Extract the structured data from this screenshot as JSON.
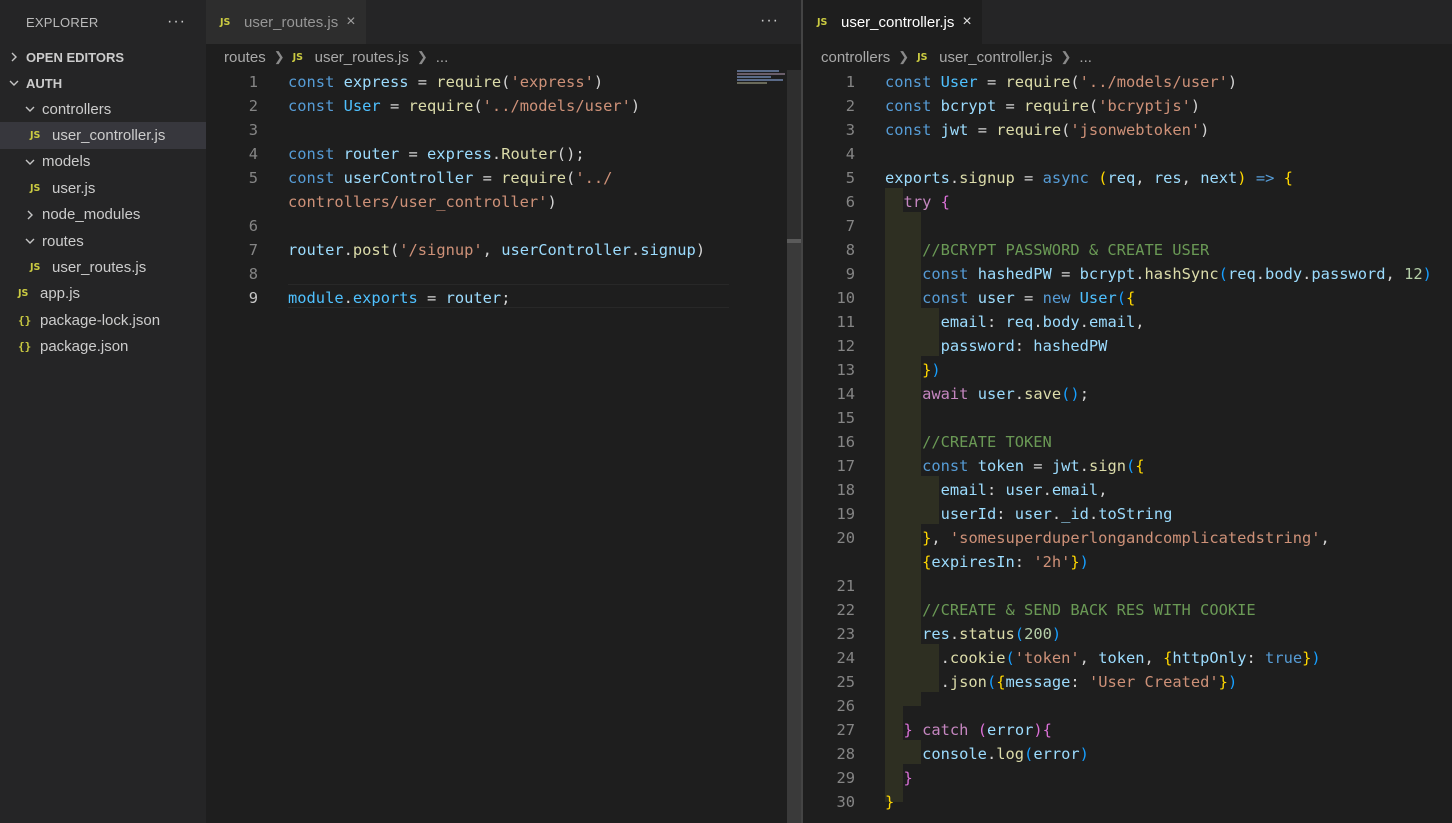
{
  "sidebar": {
    "title": "EXPLORER",
    "more": "···",
    "open_editors": "OPEN EDITORS",
    "project": "AUTH",
    "items": [
      {
        "label": "controllers"
      },
      {
        "label": "user_controller.js"
      },
      {
        "label": "models"
      },
      {
        "label": "user.js"
      },
      {
        "label": "node_modules"
      },
      {
        "label": "routes"
      },
      {
        "label": "user_routes.js"
      },
      {
        "label": "app.js"
      },
      {
        "label": "package-lock.json"
      },
      {
        "label": "package.json"
      }
    ],
    "js_badge": "JS",
    "json_badge": "{}"
  },
  "left_editor": {
    "tab": {
      "label": "user_routes.js",
      "close": "×"
    },
    "more": "···",
    "breadcrumb": {
      "folder": "routes",
      "file": "user_routes.js",
      "ellipsis": "..."
    },
    "lines": [
      {
        "n": "1",
        "parts": [
          [
            "kw",
            "const "
          ],
          [
            "var",
            "express"
          ],
          [
            "pl",
            " = "
          ],
          [
            "fn",
            "require"
          ],
          [
            "pl",
            "("
          ],
          [
            "str",
            "'express'"
          ],
          [
            "pl",
            ")"
          ]
        ]
      },
      {
        "n": "2",
        "parts": [
          [
            "kw",
            "const "
          ],
          [
            "const",
            "User"
          ],
          [
            "pl",
            " = "
          ],
          [
            "fn",
            "require"
          ],
          [
            "pl",
            "("
          ],
          [
            "str",
            "'../models/user'"
          ],
          [
            "pl",
            ")"
          ]
        ]
      },
      {
        "n": "3",
        "parts": []
      },
      {
        "n": "4",
        "parts": [
          [
            "kw",
            "const "
          ],
          [
            "var",
            "router"
          ],
          [
            "pl",
            " = "
          ],
          [
            "var",
            "express"
          ],
          [
            "pl",
            "."
          ],
          [
            "fn",
            "Router"
          ],
          [
            "pl",
            "();"
          ]
        ]
      },
      {
        "n": "5",
        "parts": [
          [
            "kw",
            "const "
          ],
          [
            "var",
            "userController"
          ],
          [
            "pl",
            " = "
          ],
          [
            "fn",
            "require"
          ],
          [
            "pl",
            "("
          ],
          [
            "str",
            "'../"
          ]
        ]
      },
      {
        "n": "",
        "parts": [
          [
            "str",
            "controllers/user_controller'"
          ],
          [
            "pl",
            ")"
          ]
        ]
      },
      {
        "n": "6",
        "parts": []
      },
      {
        "n": "7",
        "parts": [
          [
            "var",
            "router"
          ],
          [
            "pl",
            "."
          ],
          [
            "fn",
            "post"
          ],
          [
            "pl",
            "("
          ],
          [
            "str",
            "'/signup'"
          ],
          [
            "pl",
            ", "
          ],
          [
            "var",
            "userController"
          ],
          [
            "pl",
            "."
          ],
          [
            "var",
            "signup"
          ],
          [
            "pl",
            ")"
          ]
        ]
      },
      {
        "n": "8",
        "parts": []
      },
      {
        "n": "9",
        "parts": [
          [
            "const",
            "module"
          ],
          [
            "pl",
            "."
          ],
          [
            "const",
            "exports"
          ],
          [
            "pl",
            " = "
          ],
          [
            "var",
            "router"
          ],
          [
            "pl",
            ";"
          ]
        ]
      }
    ]
  },
  "right_editor": {
    "tab": {
      "label": "user_controller.js",
      "close": "×"
    },
    "breadcrumb": {
      "folder": "controllers",
      "file": "user_controller.js",
      "ellipsis": "..."
    },
    "lines": [
      {
        "n": "1",
        "parts": [
          [
            "kw",
            "const "
          ],
          [
            "const",
            "User"
          ],
          [
            "pl",
            " = "
          ],
          [
            "fn",
            "require"
          ],
          [
            "pl",
            "("
          ],
          [
            "str",
            "'../models/user'"
          ],
          [
            "pl",
            ")"
          ]
        ]
      },
      {
        "n": "2",
        "parts": [
          [
            "kw",
            "const "
          ],
          [
            "var",
            "bcrypt"
          ],
          [
            "pl",
            " = "
          ],
          [
            "fn",
            "require"
          ],
          [
            "pl",
            "("
          ],
          [
            "str",
            "'bcryptjs'"
          ],
          [
            "pl",
            ")"
          ]
        ]
      },
      {
        "n": "3",
        "parts": [
          [
            "kw",
            "const "
          ],
          [
            "var",
            "jwt"
          ],
          [
            "pl",
            " = "
          ],
          [
            "fn",
            "require"
          ],
          [
            "pl",
            "("
          ],
          [
            "str",
            "'jsonwebtoken'"
          ],
          [
            "pl",
            ")"
          ]
        ]
      },
      {
        "n": "4",
        "parts": []
      },
      {
        "n": "5",
        "parts": [
          [
            "var",
            "exports"
          ],
          [
            "pl",
            "."
          ],
          [
            "fn",
            "signup"
          ],
          [
            "pl",
            " = "
          ],
          [
            "kw",
            "async"
          ],
          [
            "pl",
            " "
          ],
          [
            "b1",
            "("
          ],
          [
            "var",
            "req"
          ],
          [
            "pl",
            ", "
          ],
          [
            "var",
            "res"
          ],
          [
            "pl",
            ", "
          ],
          [
            "var",
            "next"
          ],
          [
            "b1",
            ")"
          ],
          [
            "pl",
            " "
          ],
          [
            "kw",
            "=>"
          ],
          [
            "pl",
            " "
          ],
          [
            "b1",
            "{"
          ]
        ]
      },
      {
        "n": "6",
        "parts": [
          [
            "pl",
            "  "
          ],
          [
            "ctl",
            "try"
          ],
          [
            "pl",
            " "
          ],
          [
            "b2",
            "{"
          ]
        ]
      },
      {
        "n": "7",
        "parts": []
      },
      {
        "n": "8",
        "parts": [
          [
            "pl",
            "    "
          ],
          [
            "cm",
            "//BCRYPT PASSWORD & CREATE USER"
          ]
        ]
      },
      {
        "n": "9",
        "parts": [
          [
            "pl",
            "    "
          ],
          [
            "kw",
            "const "
          ],
          [
            "var",
            "hashedPW"
          ],
          [
            "pl",
            " = "
          ],
          [
            "var",
            "bcrypt"
          ],
          [
            "pl",
            "."
          ],
          [
            "fn",
            "hashSync"
          ],
          [
            "b3",
            "("
          ],
          [
            "var",
            "req"
          ],
          [
            "pl",
            "."
          ],
          [
            "var",
            "body"
          ],
          [
            "pl",
            "."
          ],
          [
            "var",
            "password"
          ],
          [
            "pl",
            ", "
          ],
          [
            "num",
            "12"
          ],
          [
            "b3",
            ")"
          ]
        ]
      },
      {
        "n": "10",
        "parts": [
          [
            "pl",
            "    "
          ],
          [
            "kw",
            "const "
          ],
          [
            "var",
            "user"
          ],
          [
            "pl",
            " = "
          ],
          [
            "kw",
            "new "
          ],
          [
            "const",
            "User"
          ],
          [
            "b3",
            "("
          ],
          [
            "b1",
            "{"
          ]
        ]
      },
      {
        "n": "11",
        "parts": [
          [
            "pl",
            "      "
          ],
          [
            "var",
            "email"
          ],
          [
            "pl",
            ": "
          ],
          [
            "var",
            "req"
          ],
          [
            "pl",
            "."
          ],
          [
            "var",
            "body"
          ],
          [
            "pl",
            "."
          ],
          [
            "var",
            "email"
          ],
          [
            "pl",
            ","
          ]
        ]
      },
      {
        "n": "12",
        "parts": [
          [
            "pl",
            "      "
          ],
          [
            "var",
            "password"
          ],
          [
            "pl",
            ": "
          ],
          [
            "var",
            "hashedPW"
          ]
        ]
      },
      {
        "n": "13",
        "parts": [
          [
            "pl",
            "    "
          ],
          [
            "b1",
            "}"
          ],
          [
            "b3",
            ")"
          ]
        ]
      },
      {
        "n": "14",
        "parts": [
          [
            "pl",
            "    "
          ],
          [
            "ctl",
            "await"
          ],
          [
            "pl",
            " "
          ],
          [
            "var",
            "user"
          ],
          [
            "pl",
            "."
          ],
          [
            "fn",
            "save"
          ],
          [
            "b3",
            "()"
          ],
          [
            "pl",
            ";"
          ]
        ]
      },
      {
        "n": "15",
        "parts": []
      },
      {
        "n": "16",
        "parts": [
          [
            "pl",
            "    "
          ],
          [
            "cm",
            "//CREATE TOKEN"
          ]
        ]
      },
      {
        "n": "17",
        "parts": [
          [
            "pl",
            "    "
          ],
          [
            "kw",
            "const "
          ],
          [
            "var",
            "token"
          ],
          [
            "pl",
            " = "
          ],
          [
            "var",
            "jwt"
          ],
          [
            "pl",
            "."
          ],
          [
            "fn",
            "sign"
          ],
          [
            "b3",
            "("
          ],
          [
            "b1",
            "{"
          ]
        ]
      },
      {
        "n": "18",
        "parts": [
          [
            "pl",
            "      "
          ],
          [
            "var",
            "email"
          ],
          [
            "pl",
            ": "
          ],
          [
            "var",
            "user"
          ],
          [
            "pl",
            "."
          ],
          [
            "var",
            "email"
          ],
          [
            "pl",
            ","
          ]
        ]
      },
      {
        "n": "19",
        "parts": [
          [
            "pl",
            "      "
          ],
          [
            "var",
            "userId"
          ],
          [
            "pl",
            ": "
          ],
          [
            "var",
            "user"
          ],
          [
            "pl",
            "."
          ],
          [
            "var",
            "_id"
          ],
          [
            "pl",
            "."
          ],
          [
            "var",
            "toString"
          ]
        ]
      },
      {
        "n": "20",
        "parts": [
          [
            "pl",
            "    "
          ],
          [
            "b1",
            "}"
          ],
          [
            "pl",
            ", "
          ],
          [
            "str",
            "'somesuperduperlongandcomplicatedstring'"
          ],
          [
            "pl",
            ","
          ]
        ]
      },
      {
        "n": "",
        "parts": [
          [
            "pl",
            "    "
          ],
          [
            "b1",
            "{"
          ],
          [
            "var",
            "expiresIn"
          ],
          [
            "pl",
            ": "
          ],
          [
            "str",
            "'2h'"
          ],
          [
            "b1",
            "}"
          ],
          [
            "b3",
            ")"
          ]
        ]
      },
      {
        "n": "21",
        "parts": []
      },
      {
        "n": "22",
        "parts": [
          [
            "pl",
            "    "
          ],
          [
            "cm",
            "//CREATE & SEND BACK RES WITH COOKIE"
          ]
        ]
      },
      {
        "n": "23",
        "parts": [
          [
            "pl",
            "    "
          ],
          [
            "var",
            "res"
          ],
          [
            "pl",
            "."
          ],
          [
            "fn",
            "status"
          ],
          [
            "b3",
            "("
          ],
          [
            "num",
            "200"
          ],
          [
            "b3",
            ")"
          ]
        ]
      },
      {
        "n": "24",
        "parts": [
          [
            "pl",
            "      ."
          ],
          [
            "fn",
            "cookie"
          ],
          [
            "b3",
            "("
          ],
          [
            "str",
            "'token'"
          ],
          [
            "pl",
            ", "
          ],
          [
            "var",
            "token"
          ],
          [
            "pl",
            ", "
          ],
          [
            "b1",
            "{"
          ],
          [
            "var",
            "httpOnly"
          ],
          [
            "pl",
            ": "
          ],
          [
            "kw",
            "true"
          ],
          [
            "b1",
            "}"
          ],
          [
            "b3",
            ")"
          ]
        ]
      },
      {
        "n": "25",
        "parts": [
          [
            "pl",
            "      ."
          ],
          [
            "fn",
            "json"
          ],
          [
            "b3",
            "("
          ],
          [
            "b1",
            "{"
          ],
          [
            "var",
            "message"
          ],
          [
            "pl",
            ": "
          ],
          [
            "str",
            "'User Created'"
          ],
          [
            "b1",
            "}"
          ],
          [
            "b3",
            ")"
          ]
        ]
      },
      {
        "n": "26",
        "parts": []
      },
      {
        "n": "27",
        "parts": [
          [
            "pl",
            "  "
          ],
          [
            "b2",
            "}"
          ],
          [
            "pl",
            " "
          ],
          [
            "ctl",
            "catch"
          ],
          [
            "pl",
            " "
          ],
          [
            "b2",
            "("
          ],
          [
            "var",
            "error"
          ],
          [
            "b2",
            ")"
          ],
          [
            "b2",
            "{"
          ]
        ]
      },
      {
        "n": "28",
        "parts": [
          [
            "pl",
            "    "
          ],
          [
            "var",
            "console"
          ],
          [
            "pl",
            "."
          ],
          [
            "fn",
            "log"
          ],
          [
            "b3",
            "("
          ],
          [
            "var",
            "error"
          ],
          [
            "b3",
            ")"
          ]
        ]
      },
      {
        "n": "29",
        "parts": [
          [
            "pl",
            "  "
          ],
          [
            "b2",
            "}"
          ]
        ]
      },
      {
        "n": "30",
        "parts": [
          [
            "b1",
            "}"
          ]
        ]
      }
    ]
  },
  "colors": {
    "editor_bg": "#1e1e1e",
    "sidebar_bg": "#252526",
    "keyword": "#569cd6",
    "variable": "#9cdcfe",
    "function": "#dcdcaa",
    "string": "#ce9178",
    "comment": "#6a9955",
    "js_badge": "#cbcb41"
  }
}
